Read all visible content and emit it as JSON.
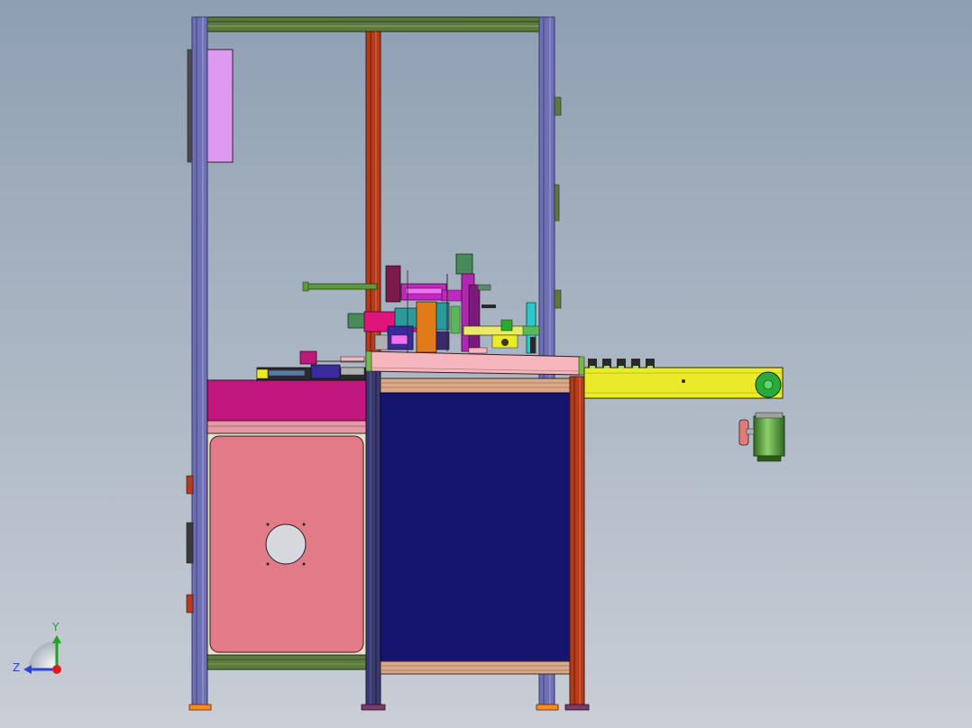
{
  "viewport": {
    "background_top": "#8e9fb2",
    "background_bottom": "#c9ced6"
  },
  "triad": {
    "y_label": "Y",
    "z_label": "Z",
    "y_color": "#19a819",
    "z_color": "#2b43d8",
    "x_color": "#e01b1b"
  },
  "colors": {
    "frame_post": "#6f6fb4",
    "frame_post_edge": "#35356e",
    "frame_rail": "#5c7a3e",
    "red_post": "#b63b1a",
    "pink_cabinet": "#e27a88",
    "navy_cabinet": "#151570",
    "magenta_panel": "#c0177d",
    "light_pink_plate": "#f5b6be",
    "yellow_conveyor": "#eaea2a",
    "motor_green": "#5a9a3a",
    "violet_panel": "#dd9aee",
    "foot_orange": "#ff8a1c",
    "foot_purple": "#7a3a6a"
  }
}
